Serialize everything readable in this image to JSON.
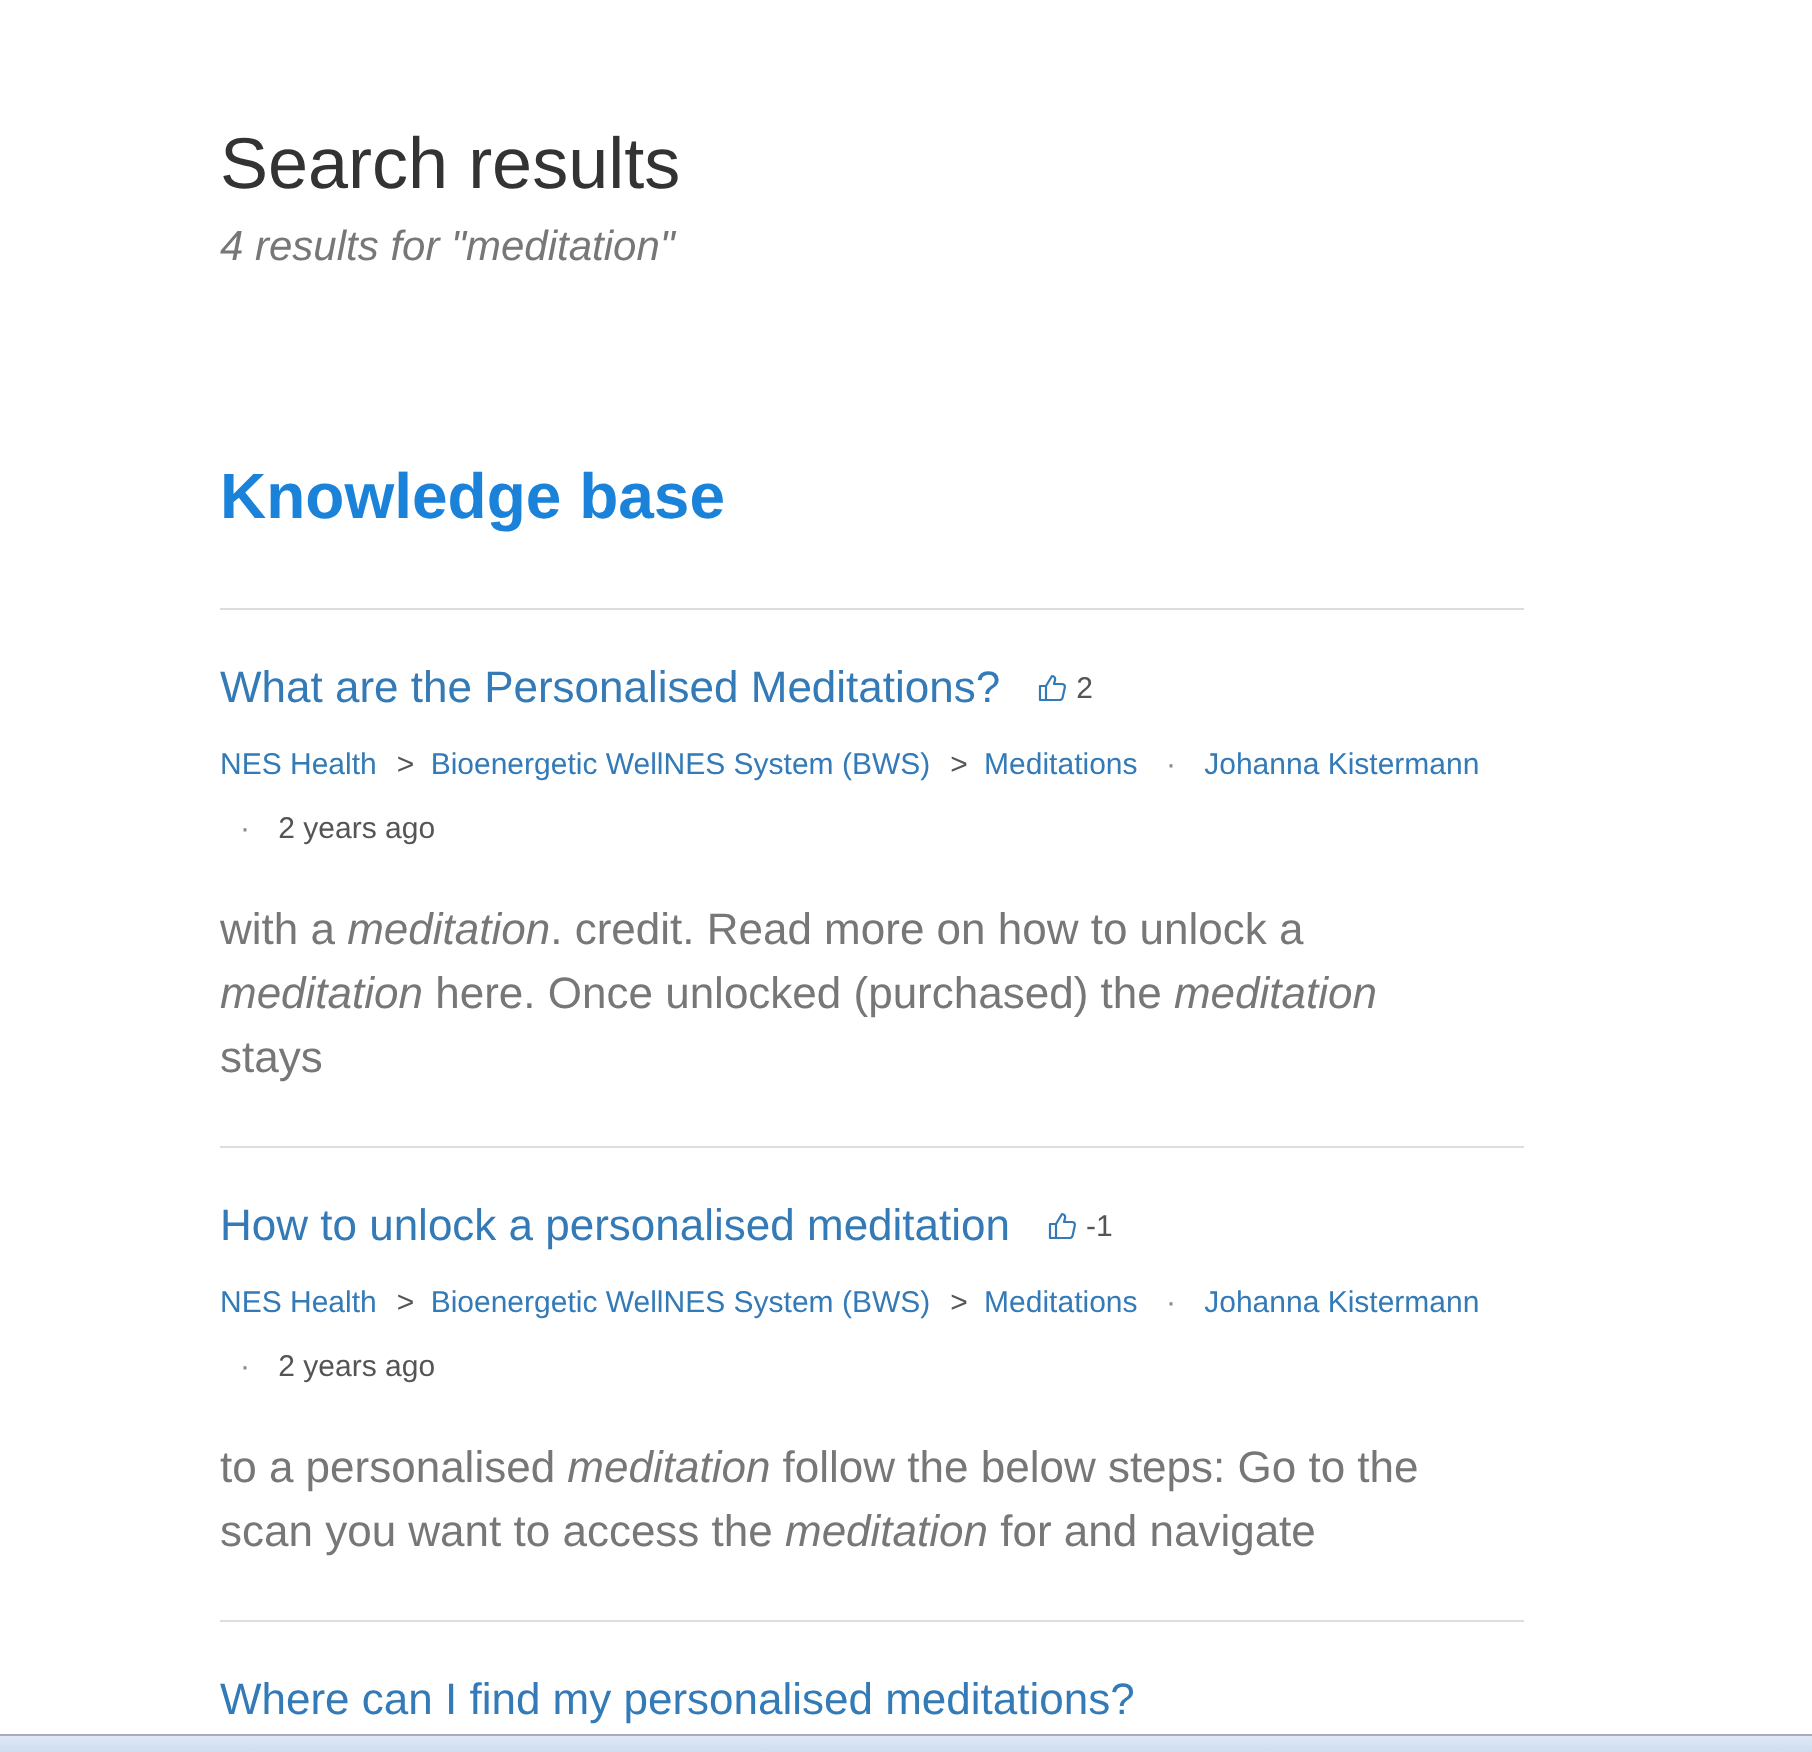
{
  "page_title": "Search results",
  "result_count": "4 results for \"meditation\"",
  "section_heading": "Knowledge base",
  "results": [
    {
      "title": "What are the Personalised Meditations?",
      "votes": "2",
      "breadcrumbs": [
        {
          "label": "NES Health"
        },
        {
          "separator": ">",
          "label": "Bioenergetic WellNES System (BWS)"
        },
        {
          "separator": ">",
          "label": "Meditations"
        }
      ],
      "author_separator": "·",
      "author": "Johanna Kistermann",
      "age_separator": "·",
      "age": "2 years ago",
      "snippet": "with a *meditation*. credit. Read more on how to unlock a *meditation* here. Once unlocked (purchased) the *meditation* stays"
    },
    {
      "title": "How to unlock a personalised meditation",
      "votes": "-1",
      "breadcrumbs": [
        {
          "label": "NES Health"
        },
        {
          "separator": ">",
          "label": "Bioenergetic WellNES System (BWS)"
        },
        {
          "separator": ">",
          "label": "Meditations"
        }
      ],
      "author_separator": "·",
      "author": "Johanna Kistermann",
      "age_separator": "·",
      "age": "2 years ago",
      "snippet": "to a personalised *meditation* follow the below steps: Go to the scan you want to access the *meditation* for and navigate"
    },
    {
      "title": "Where can I find my personalised meditations?"
    }
  ]
}
